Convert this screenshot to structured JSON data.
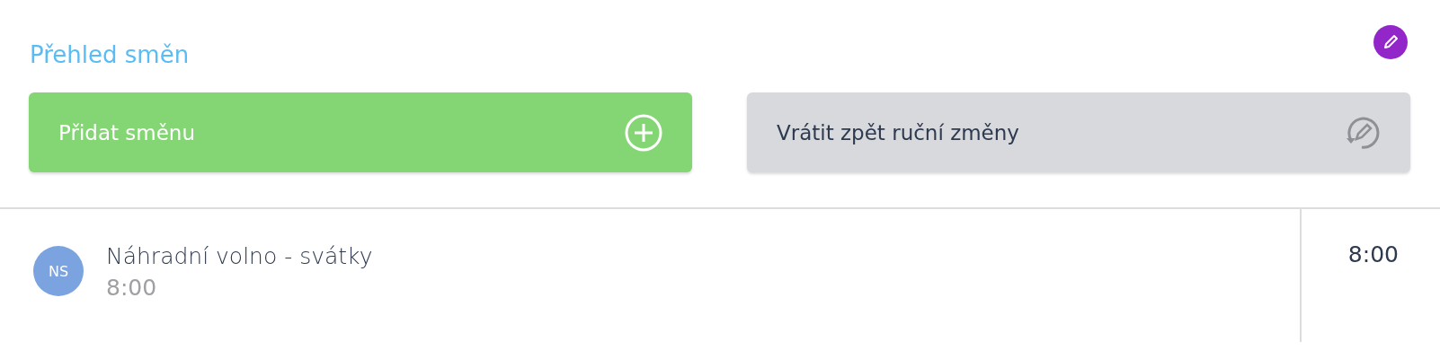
{
  "title": "Přehled směn",
  "buttons": [
    {
      "label": "Přidat směnu",
      "kind": "add"
    },
    {
      "label": "Vrátit zpět ruční změny",
      "kind": "revert"
    }
  ],
  "shifts": [
    {
      "initials": "NS",
      "color": "#7ba3e0",
      "name": "Náhradní volno - svátky",
      "time": "8:00",
      "total": "8:00"
    }
  ]
}
